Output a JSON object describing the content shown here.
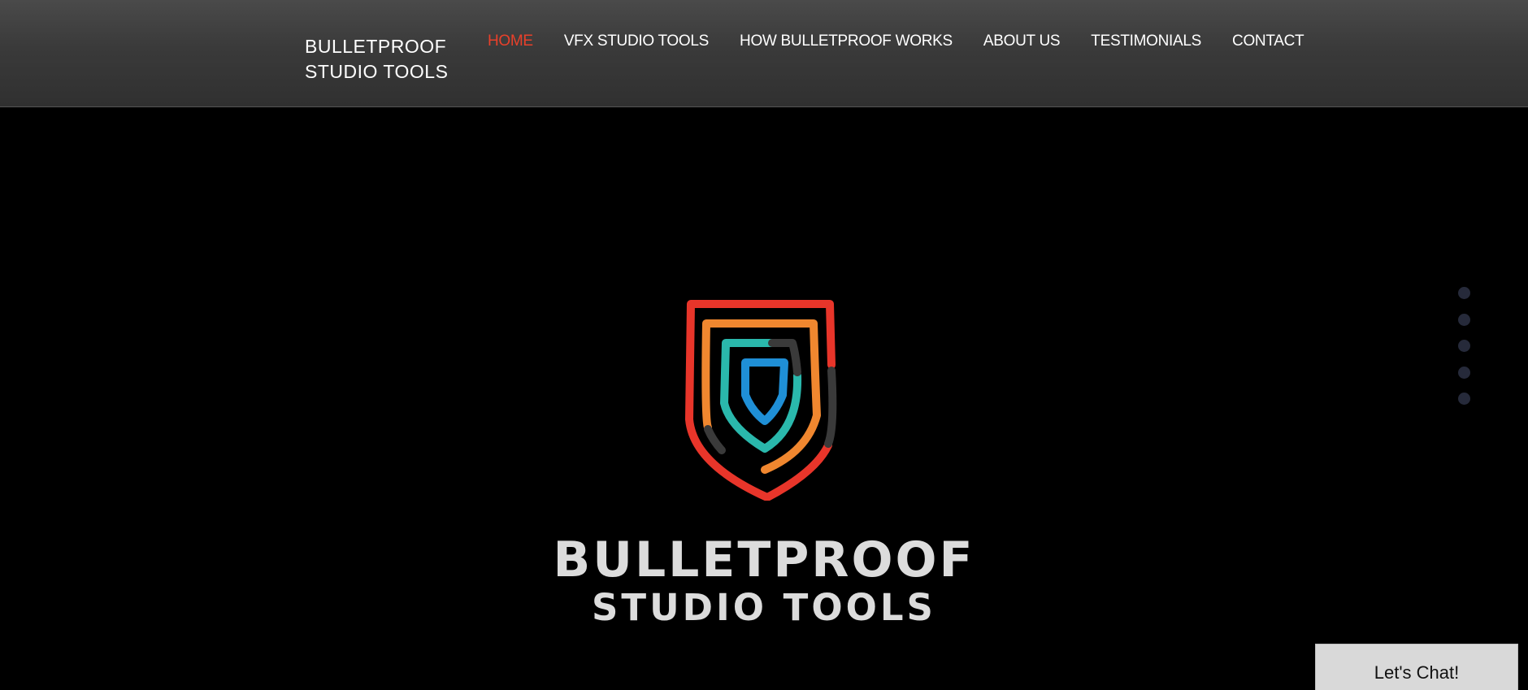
{
  "header": {
    "brand_line1": "BULLETPROOF",
    "brand_line2": "STUDIO TOOLS",
    "nav": [
      {
        "label": "HOME",
        "active": true
      },
      {
        "label": "VFX STUDIO TOOLS",
        "active": false
      },
      {
        "label": "HOW BULLETPROOF WORKS",
        "active": false
      },
      {
        "label": "ABOUT US",
        "active": false
      },
      {
        "label": "TESTIMONIALS",
        "active": false
      },
      {
        "label": "CONTACT",
        "active": false
      }
    ]
  },
  "hero": {
    "logo_icon": "shield-rings-logo",
    "wordmark_line1": "BULLETPROOF",
    "wordmark_line2": "STUDIO TOOLS",
    "slide_dots_count": 5
  },
  "chat": {
    "label": "Let's Chat!"
  },
  "colors": {
    "accent_red": "#e8402a",
    "logo_orange": "#f0872f",
    "logo_teal": "#2ab8ac",
    "logo_blue": "#1f8fd6",
    "logo_gray": "#3a3a3a",
    "wordmark": "#dcdcdc",
    "dot": "#262a3a"
  }
}
